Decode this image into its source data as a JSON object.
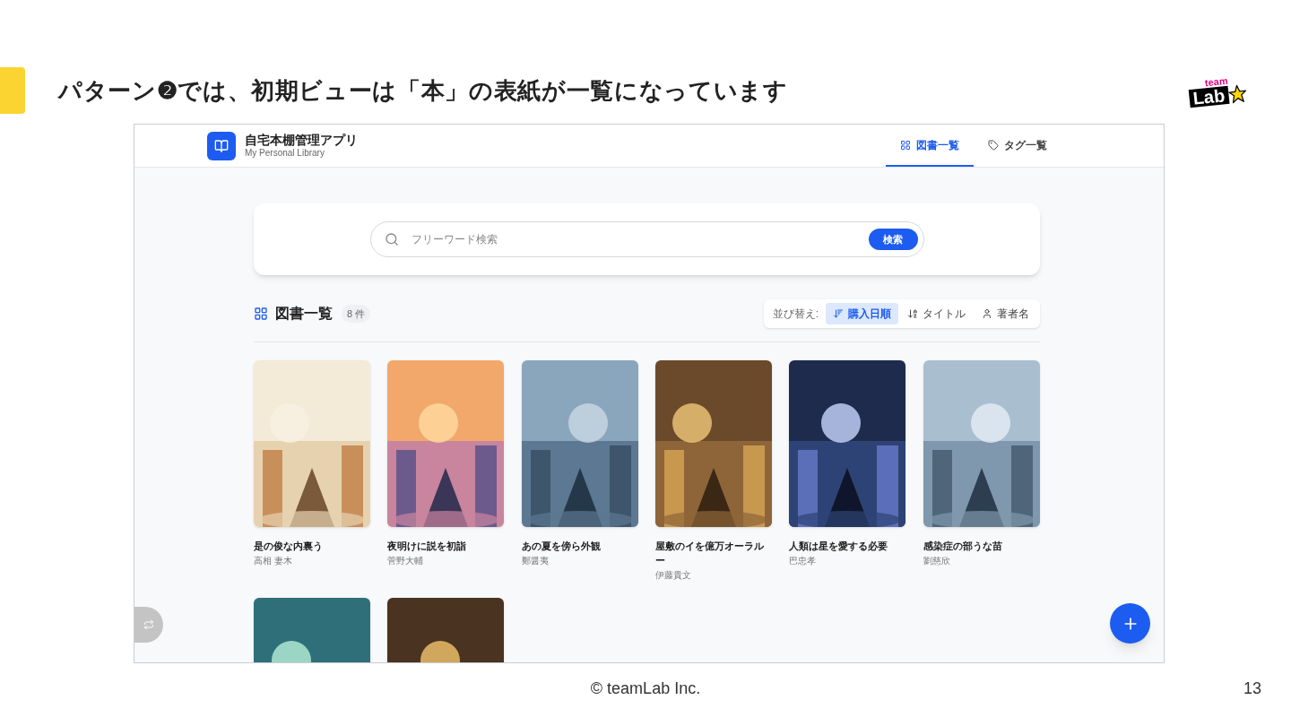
{
  "slide": {
    "heading": "パターン❷では、初期ビューは「本」の表紙が一覧になっています",
    "logo": {
      "top": "team",
      "bottom": "Lab"
    },
    "footer": "© teamLab Inc.",
    "page_number": "13"
  },
  "app": {
    "title": "自宅本棚管理アプリ",
    "subtitle": "My Personal Library",
    "nav": [
      {
        "label": "図書一覧",
        "selected": true
      },
      {
        "label": "タグ一覧",
        "selected": false
      }
    ],
    "search": {
      "placeholder": "フリーワード検索",
      "button": "検索"
    },
    "section": {
      "title": "図書一覧",
      "count": "8 件"
    },
    "sort": {
      "label": "並び替え:",
      "options": [
        {
          "label": "購入日順",
          "selected": true
        },
        {
          "label": "タイトル",
          "selected": false
        },
        {
          "label": "著者名",
          "selected": false
        }
      ]
    },
    "books": [
      {
        "kind": "picture",
        "title": "是の俊な内裏う",
        "author": "高相 妻木"
      },
      {
        "kind": "picture",
        "title": "夜明けに説を初詣",
        "author": "菅野大輔"
      },
      {
        "kind": "picture",
        "title": "あの夏を傍ら外観",
        "author": "鄭醤夷"
      },
      {
        "kind": "picture",
        "title": "屋敷のイを億万オーラルー",
        "author": "伊藤貴文"
      },
      {
        "kind": "picture",
        "title": "人類は星を愛する必要",
        "author": "巴忠孝"
      },
      {
        "kind": "picture",
        "title": "感染症の部うな苗",
        "author": "劉慈欣"
      },
      {
        "kind": "picture"
      },
      {
        "kind": "picture"
      }
    ]
  }
}
